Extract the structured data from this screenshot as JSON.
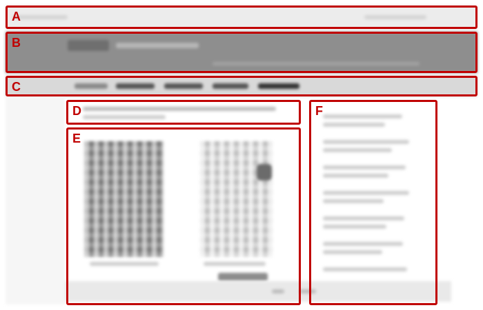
{
  "regions": [
    {
      "id": "A",
      "label": "A"
    },
    {
      "id": "B",
      "label": "B"
    },
    {
      "id": "C",
      "label": "C"
    },
    {
      "id": "D",
      "label": "D"
    },
    {
      "id": "E",
      "label": "E"
    },
    {
      "id": "F",
      "label": "F"
    }
  ],
  "colors": {
    "annotation": "#c00000",
    "header_bg": "#8e8e8e",
    "nav_bg": "#d9d9d9",
    "topbar_bg": "#ececec"
  },
  "content_note": ""
}
